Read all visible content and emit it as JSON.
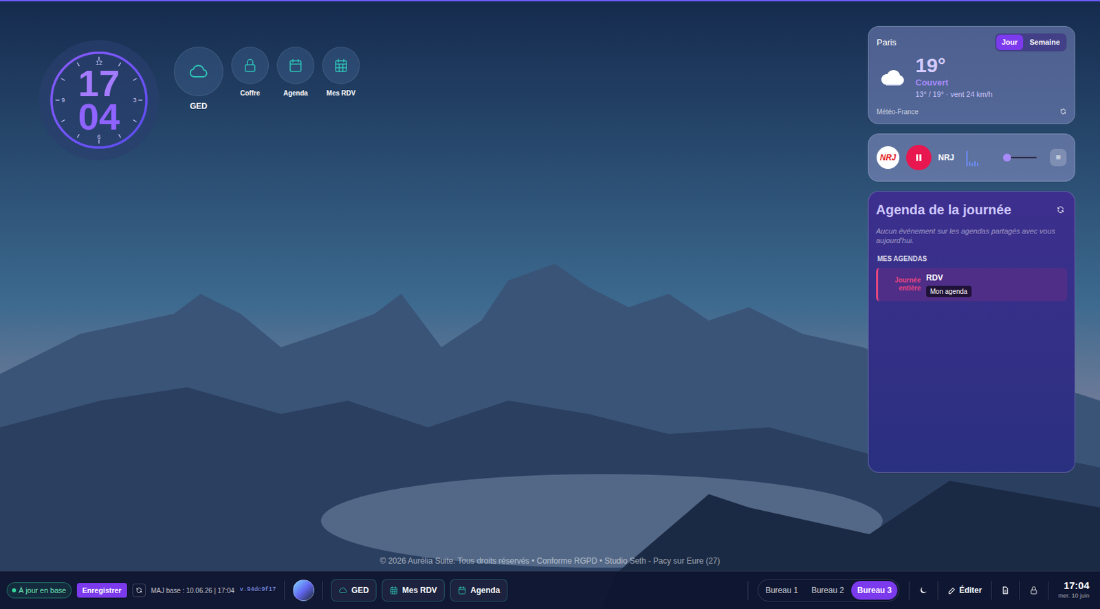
{
  "clock": {
    "hours": "17",
    "minutes": "04",
    "dial": [
      "12",
      "3",
      "6",
      "9"
    ]
  },
  "desktop_icons": [
    {
      "label": "GED",
      "kind": "cloud"
    },
    {
      "label": "Coffre",
      "kind": "lock"
    },
    {
      "label": "Agenda",
      "kind": "calendar"
    },
    {
      "label": "Mes RDV",
      "kind": "grid"
    }
  ],
  "weather": {
    "city": "Paris",
    "tabs": [
      {
        "label": "Jour",
        "selected": true
      },
      {
        "label": "Semaine",
        "selected": false
      }
    ],
    "temperature": "19°",
    "condition": "Couvert",
    "details": "13° / 19° · vent 24 km/h",
    "source": "Météo-France"
  },
  "radio": {
    "logo_text": "NRJ",
    "station": "NRJ",
    "playing": true,
    "visualizer": [
      0.9,
      0.25,
      0.2,
      0.3,
      0.2
    ],
    "volume": 0.1,
    "menu": "≡"
  },
  "agenda": {
    "title": "Agenda de la journée",
    "empty_message": "Aucun événement sur les agendas partagés avec vous aujourd'hui.",
    "section": "MES AGENDAS",
    "events": [
      {
        "time": "Journée entière",
        "title": "RDV",
        "calendar": "Mon agenda",
        "color": "#e8467f"
      }
    ]
  },
  "footer": "© 2026 Aurélia Suite. Tous droits réservés • Conforme RGPD • Studio Seth - Pacy sur Eure (27)",
  "taskbar": {
    "sync_status": "À jour en base",
    "synced": true,
    "save_button": "Enregistrer",
    "db_update": "MAJ base : 10.06.26 | 17:04",
    "version": "v.94dc9f17",
    "pinned": [
      {
        "label": "GED",
        "kind": "cloud"
      },
      {
        "label": "Mes RDV",
        "kind": "grid"
      },
      {
        "label": "Agenda",
        "kind": "calendar"
      }
    ],
    "desktops": [
      {
        "label": "Bureau 1",
        "selected": false
      },
      {
        "label": "Bureau 2",
        "selected": false
      },
      {
        "label": "Bureau 3",
        "selected": true
      }
    ],
    "edit_button": "Éditer",
    "time": "17:04",
    "date": "mer. 10 juin"
  }
}
